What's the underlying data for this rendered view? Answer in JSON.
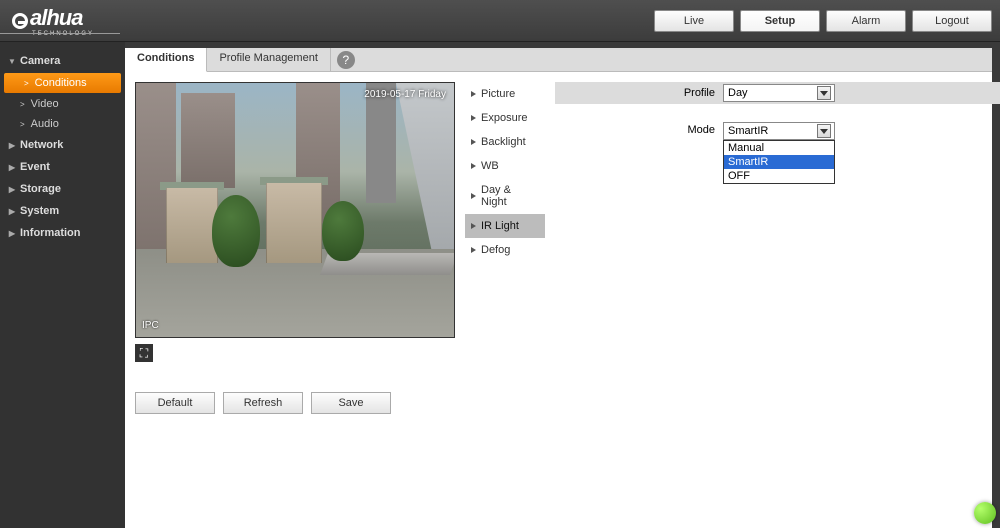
{
  "brand": {
    "main": "alhua",
    "sub": "TECHNOLOGY"
  },
  "topnav": {
    "live": "Live",
    "setup": "Setup",
    "alarm": "Alarm",
    "logout": "Logout"
  },
  "sidebar": {
    "camera": "Camera",
    "camera_items": {
      "conditions": "Conditions",
      "video": "Video",
      "audio": "Audio"
    },
    "network": "Network",
    "event": "Event",
    "storage": "Storage",
    "system": "System",
    "information": "Information"
  },
  "tabs": {
    "conditions": "Conditions",
    "profile_mgmt": "Profile Management"
  },
  "preview": {
    "timestamp": "2019-05-17 Friday",
    "label": "IPC"
  },
  "buttons": {
    "default": "Default",
    "refresh": "Refresh",
    "save": "Save"
  },
  "midmenu": {
    "picture": "Picture",
    "exposure": "Exposure",
    "backlight": "Backlight",
    "wb": "WB",
    "daynight": "Day & Night",
    "irlight": "IR Light",
    "defog": "Defog"
  },
  "profile": {
    "label": "Profile",
    "value": "Day"
  },
  "mode": {
    "label": "Mode",
    "value": "SmartIR",
    "options": [
      "Manual",
      "SmartIR",
      "OFF"
    ],
    "highlighted_index": 1
  }
}
